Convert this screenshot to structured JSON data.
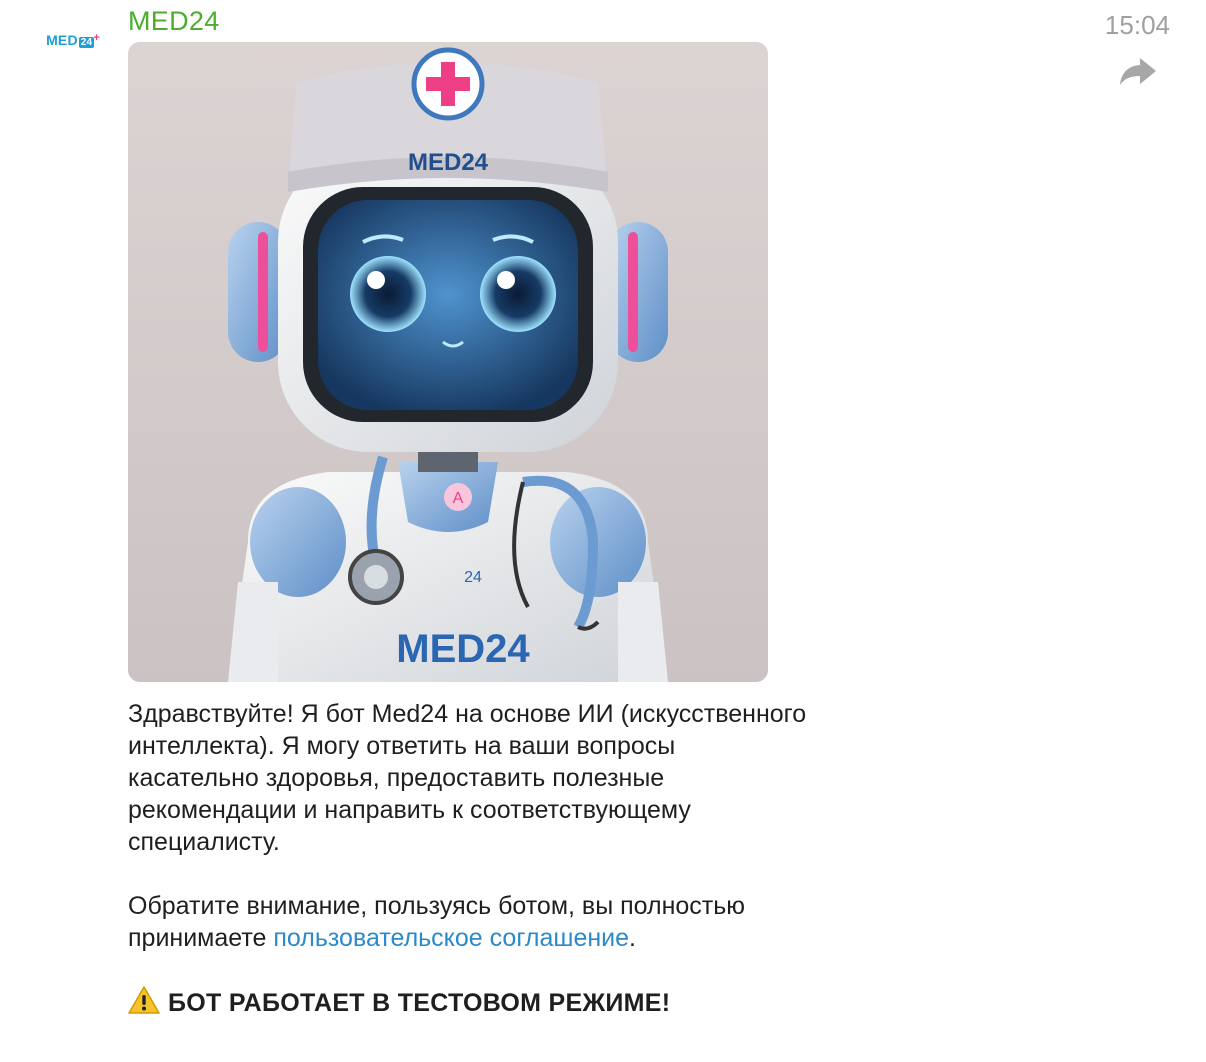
{
  "avatar": {
    "logo_text": "MED",
    "logo_box": "24",
    "logo_plus": "+"
  },
  "message": {
    "sender": "MED24",
    "time": "15:04",
    "image": {
      "cap_label": "MED24",
      "chest_label": "MED24",
      "badge_label": "24",
      "neck_badge": "A"
    },
    "paragraph1": "Здравствуйте! Я бот Med24 на основе ИИ (искусственного интеллекта). Я могу ответить на ваши вопросы касательно здоровья, предоставить полезные рекомендации и направить к соответствующему специалисту.",
    "paragraph2_prefix": "Обратите внимание, пользуясь ботом, вы полностью принимаете ",
    "paragraph2_link": "пользовательское соглашение",
    "paragraph2_suffix": ".",
    "warning_text": "БОТ РАБОТАЕТ В ТЕСТОВОМ РЕЖИМЕ!"
  },
  "colors": {
    "sender": "#4cae2c",
    "link": "#2b8ac9",
    "time": "#a0a0a0",
    "brand_blue": "#1e9fd6",
    "brand_pink": "#ee3f86"
  },
  "icons": {
    "forward": "forward-arrow-icon",
    "warning": "warning-icon"
  }
}
